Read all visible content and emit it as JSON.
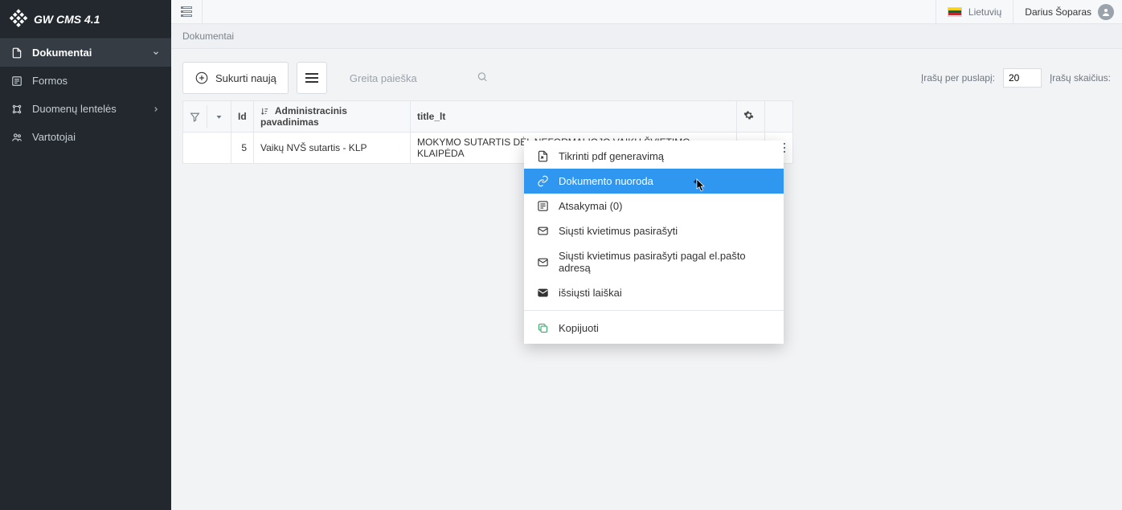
{
  "brand": {
    "title": "GW CMS 4.1"
  },
  "sidebar": {
    "items": [
      {
        "label": "Dokumentai",
        "hasChevron": true
      },
      {
        "label": "Formos"
      },
      {
        "label": "Duomenų lentelės",
        "hasChevron": true
      },
      {
        "label": "Vartotojai"
      }
    ]
  },
  "topbar": {
    "language": "Lietuvių",
    "user": "Darius Šoparas"
  },
  "breadcrumb": "Dokumentai",
  "toolbar": {
    "create_label": "Sukurti naują",
    "search_placeholder": "Greita paieška",
    "per_page_label": "Įrašų per puslapį:",
    "per_page_value": "20",
    "count_label": "Įrašų skaičius:"
  },
  "table": {
    "columns": {
      "id": "Id",
      "admin": "Administracinis pavadinimas",
      "title": "title_lt"
    },
    "rows": [
      {
        "id": "5",
        "admin": "Vaikų NVŠ sutartis - KLP",
        "title": "MOKYMO SUTARTIS DĖL NEFORMALIOJO VAIKŲ ŠVIETIMO - KLAIPĖDA"
      }
    ]
  },
  "context_menu": {
    "items": [
      {
        "label": "Tikrinti pdf generavimą"
      },
      {
        "label": "Dokumento nuoroda",
        "highlight": true
      },
      {
        "label": "Atsakymai (0)"
      },
      {
        "label": "Siųsti kvietimus pasirašyti"
      },
      {
        "label": "Siųsti kvietimus pasirašyti pagal el.pašto adresą"
      },
      {
        "label": "išsiųsti laiškai"
      }
    ],
    "copy_label": "Kopijuoti"
  }
}
